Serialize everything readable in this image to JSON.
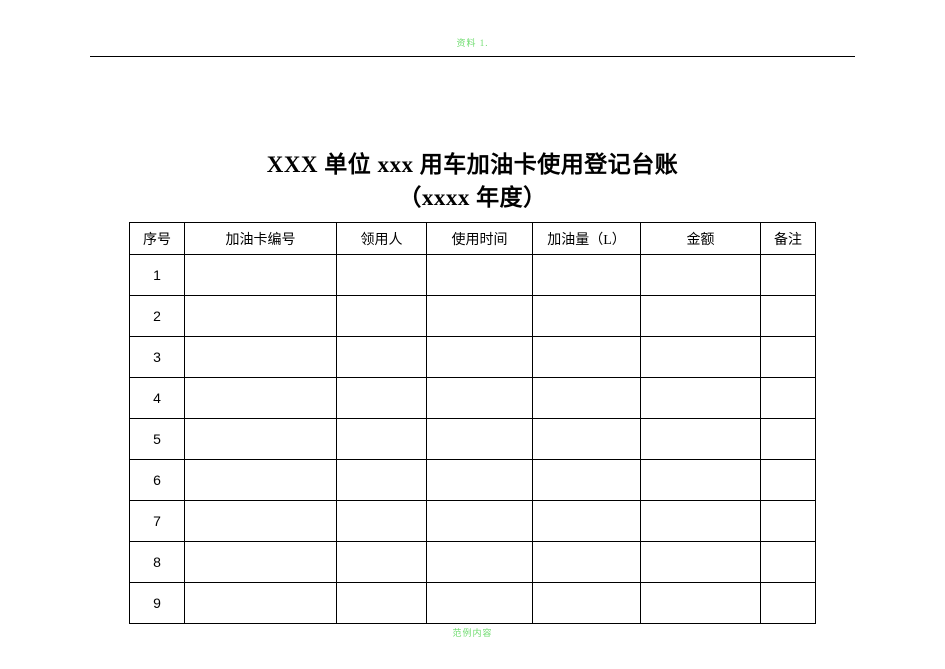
{
  "watermark": {
    "header": "资料 1.",
    "footer": "范例内容"
  },
  "title": {
    "line1": "XXX  单位 xxx 用车加油卡使用登记台账",
    "line2": "（xxxx 年度）"
  },
  "table": {
    "headers": {
      "seq": "序号",
      "card": "加油卡编号",
      "user": "领用人",
      "time": "使用时间",
      "volume": "加油量（L）",
      "amount": "金额",
      "note": "备注"
    },
    "rows": [
      {
        "seq": "1",
        "card": "",
        "user": "",
        "time": "",
        "volume": "",
        "amount": "",
        "note": ""
      },
      {
        "seq": "2",
        "card": "",
        "user": "",
        "time": "",
        "volume": "",
        "amount": "",
        "note": ""
      },
      {
        "seq": "3",
        "card": "",
        "user": "",
        "time": "",
        "volume": "",
        "amount": "",
        "note": ""
      },
      {
        "seq": "4",
        "card": "",
        "user": "",
        "time": "",
        "volume": "",
        "amount": "",
        "note": ""
      },
      {
        "seq": "5",
        "card": "",
        "user": "",
        "time": "",
        "volume": "",
        "amount": "",
        "note": ""
      },
      {
        "seq": "6",
        "card": "",
        "user": "",
        "time": "",
        "volume": "",
        "amount": "",
        "note": ""
      },
      {
        "seq": "7",
        "card": "",
        "user": "",
        "time": "",
        "volume": "",
        "amount": "",
        "note": ""
      },
      {
        "seq": "8",
        "card": "",
        "user": "",
        "time": "",
        "volume": "",
        "amount": "",
        "note": ""
      },
      {
        "seq": "9",
        "card": "",
        "user": "",
        "time": "",
        "volume": "",
        "amount": "",
        "note": ""
      }
    ]
  }
}
